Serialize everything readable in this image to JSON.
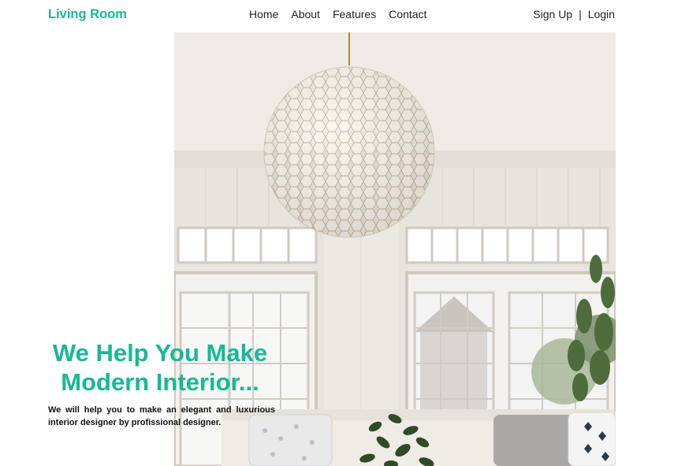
{
  "header": {
    "brand": "Living Room",
    "nav": [
      "Home",
      "About",
      "Features",
      "Contact"
    ],
    "auth": {
      "signup": "Sign Up",
      "separator": "|",
      "login": "Login"
    }
  },
  "hero": {
    "headline_line1": "We Help You Make",
    "headline_line2": "Modern Interior...",
    "description": "We will help you to make an elegant and luxurious interior designer by profissional designer."
  },
  "colors": {
    "accent": "#17b897",
    "text": "#222222"
  }
}
